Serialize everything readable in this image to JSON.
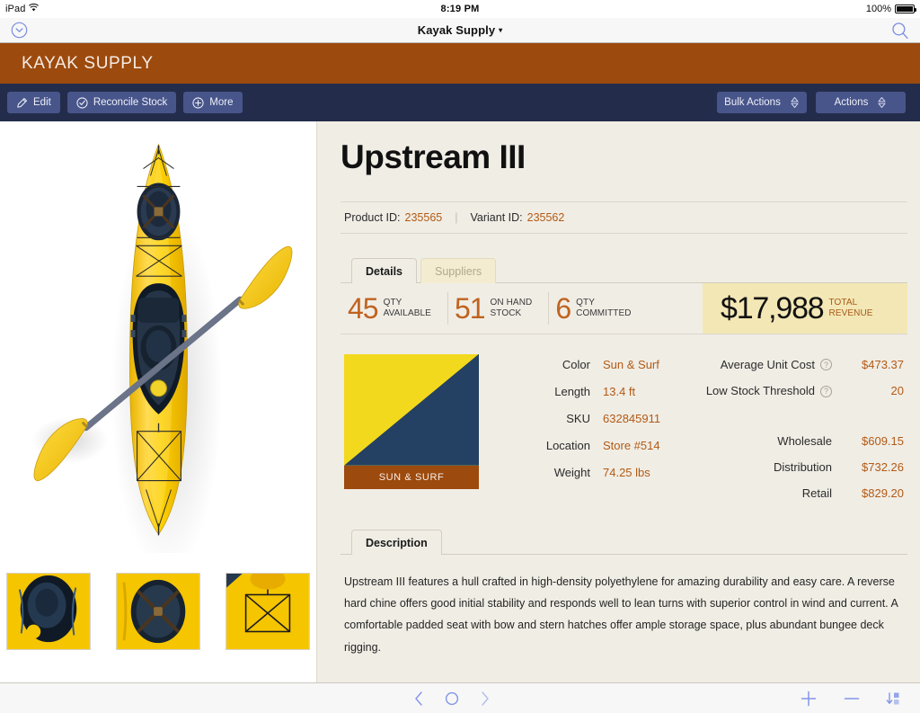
{
  "status_bar": {
    "device": "iPad",
    "wifi_icon": "wifi-icon",
    "time": "8:19 PM",
    "battery_percent": "100%",
    "battery_icon": "battery-full-icon"
  },
  "nav_bar": {
    "left_icon": "chevron-down-circle-icon",
    "title": "Kayak Supply",
    "title_caret": "▾",
    "right_icon": "search-icon"
  },
  "brand": {
    "name": "KAYAK SUPPLY",
    "band_color": "#9C4A0E"
  },
  "toolbar": {
    "background_color": "#232C4B",
    "button_color": "#48558A",
    "left_buttons": [
      {
        "label": "Edit",
        "icon": "pencil-icon"
      },
      {
        "label": "Reconcile Stock",
        "icon": "check-circle-icon"
      },
      {
        "label": "More",
        "icon": "plus-circle-icon"
      }
    ],
    "right_buttons": [
      {
        "label": "Bulk Actions",
        "icon": "stepper-updown-icon"
      },
      {
        "label": "Actions",
        "icon": "stepper-updown-icon"
      }
    ]
  },
  "gallery": {
    "hero_alt": "yellow-kayak-with-paddle",
    "thumbnails": [
      "kayak-cockpit-rear-thumbnail",
      "kayak-cockpit-seat-thumbnail",
      "kayak-deck-rigging-thumbnail"
    ]
  },
  "product": {
    "title": "Upstream III",
    "product_id_label": "Product ID:",
    "product_id": "235565",
    "variant_id_label": "Variant ID:",
    "variant_id": "235562"
  },
  "tabs": [
    {
      "label": "Details",
      "active": true
    },
    {
      "label": "Suppliers",
      "active": false
    }
  ],
  "stats": [
    {
      "value": "45",
      "label_line1": "QTY",
      "label_line2": "AVAILABLE"
    },
    {
      "value": "51",
      "label_line1": "ON HAND",
      "label_line2": "STOCK"
    },
    {
      "value": "6",
      "label_line1": "QTY",
      "label_line2": "COMMITTED"
    }
  ],
  "revenue": {
    "value": "$17,988",
    "label_line1": "TOTAL",
    "label_line2": "REVENUE",
    "background_color": "#F3E7B5"
  },
  "swatch": {
    "label": "SUN & SURF",
    "color_top": "#F2D91D",
    "color_bottom": "#244063",
    "label_background": "#9C4A0E"
  },
  "attributes": [
    {
      "key": "Color",
      "value": "Sun & Surf"
    },
    {
      "key": "Length",
      "value": "13.4 ft"
    },
    {
      "key": "SKU",
      "value": "632845911"
    },
    {
      "key": "Location",
      "value": "Store #514"
    },
    {
      "key": "Weight",
      "value": "74.25 lbs"
    }
  ],
  "costs": [
    {
      "key": "Average Unit Cost",
      "value": "$473.37",
      "has_help": true
    },
    {
      "key": "Low Stock Threshold",
      "value": "20",
      "has_help": true
    }
  ],
  "prices": [
    {
      "key": "Wholesale",
      "value": "$609.15"
    },
    {
      "key": "Distribution",
      "value": "$732.26"
    },
    {
      "key": "Retail",
      "value": "$829.20"
    }
  ],
  "description": {
    "tab_label": "Description",
    "text": "Upstream III features a hull crafted in high-density polyethylene for amazing durability and easy care. A reverse hard chine offers good initial stability and responds well to lean turns with superior control in wind and current. A comfortable padded seat with bow and stern hatches offer ample storage space, plus abundant bungee deck rigging."
  },
  "bottom_bar": {
    "left_icons": [
      "chevron-left-icon",
      "record-circle-icon",
      "chevron-right-icon"
    ],
    "right_icons": [
      "plus-icon",
      "minus-icon",
      "sort-az-icon"
    ]
  },
  "theme": {
    "accent_orange": "#B35A15",
    "stat_orange": "#C0631E",
    "content_bg": "#F0EDE5"
  }
}
